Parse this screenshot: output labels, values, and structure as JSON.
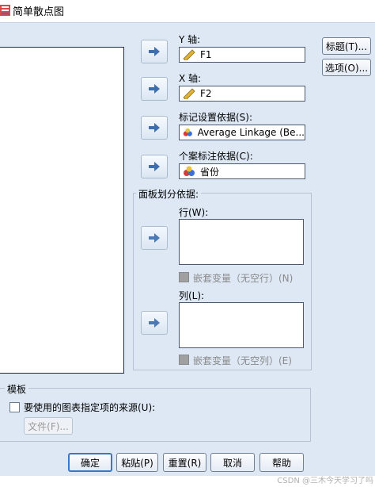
{
  "window": {
    "title": "简单散点图"
  },
  "y_axis": {
    "label": "Y 轴:",
    "value": "F1"
  },
  "x_axis": {
    "label": "X 轴:",
    "value": "F2"
  },
  "set_markers": {
    "label": "标记设置依据(S):",
    "value": "Average Linkage (Be..."
  },
  "label_cases": {
    "label": "个案标注依据(C):",
    "value": "省份"
  },
  "panel": {
    "legend": "面板划分依据:",
    "rows_label": "行(W):",
    "rows_nest": "嵌套变量（无空行）(N)",
    "cols_label": "列(L):",
    "cols_nest": "嵌套变量（无空列）(E)"
  },
  "side_buttons": {
    "titles": "标题(T)...",
    "options": "选项(O)..."
  },
  "template": {
    "legend": "模板",
    "use_spec": "要使用的图表指定项的来源(U):",
    "file_button": "文件(F)..."
  },
  "footer": {
    "ok": "确定",
    "paste": "粘贴(P)",
    "reset": "重置(R)",
    "cancel": "取消",
    "help": "帮助"
  },
  "watermark": "CSDN @三木今天学习了吗",
  "icons": {
    "move_arrow": "arrow-right-icon",
    "scale_variable": "ruler-icon",
    "nominal_variable": "nominal-variable-icon"
  },
  "colors": {
    "dialog_bg": "#dde8f4",
    "default_border": "#3a78c7"
  }
}
